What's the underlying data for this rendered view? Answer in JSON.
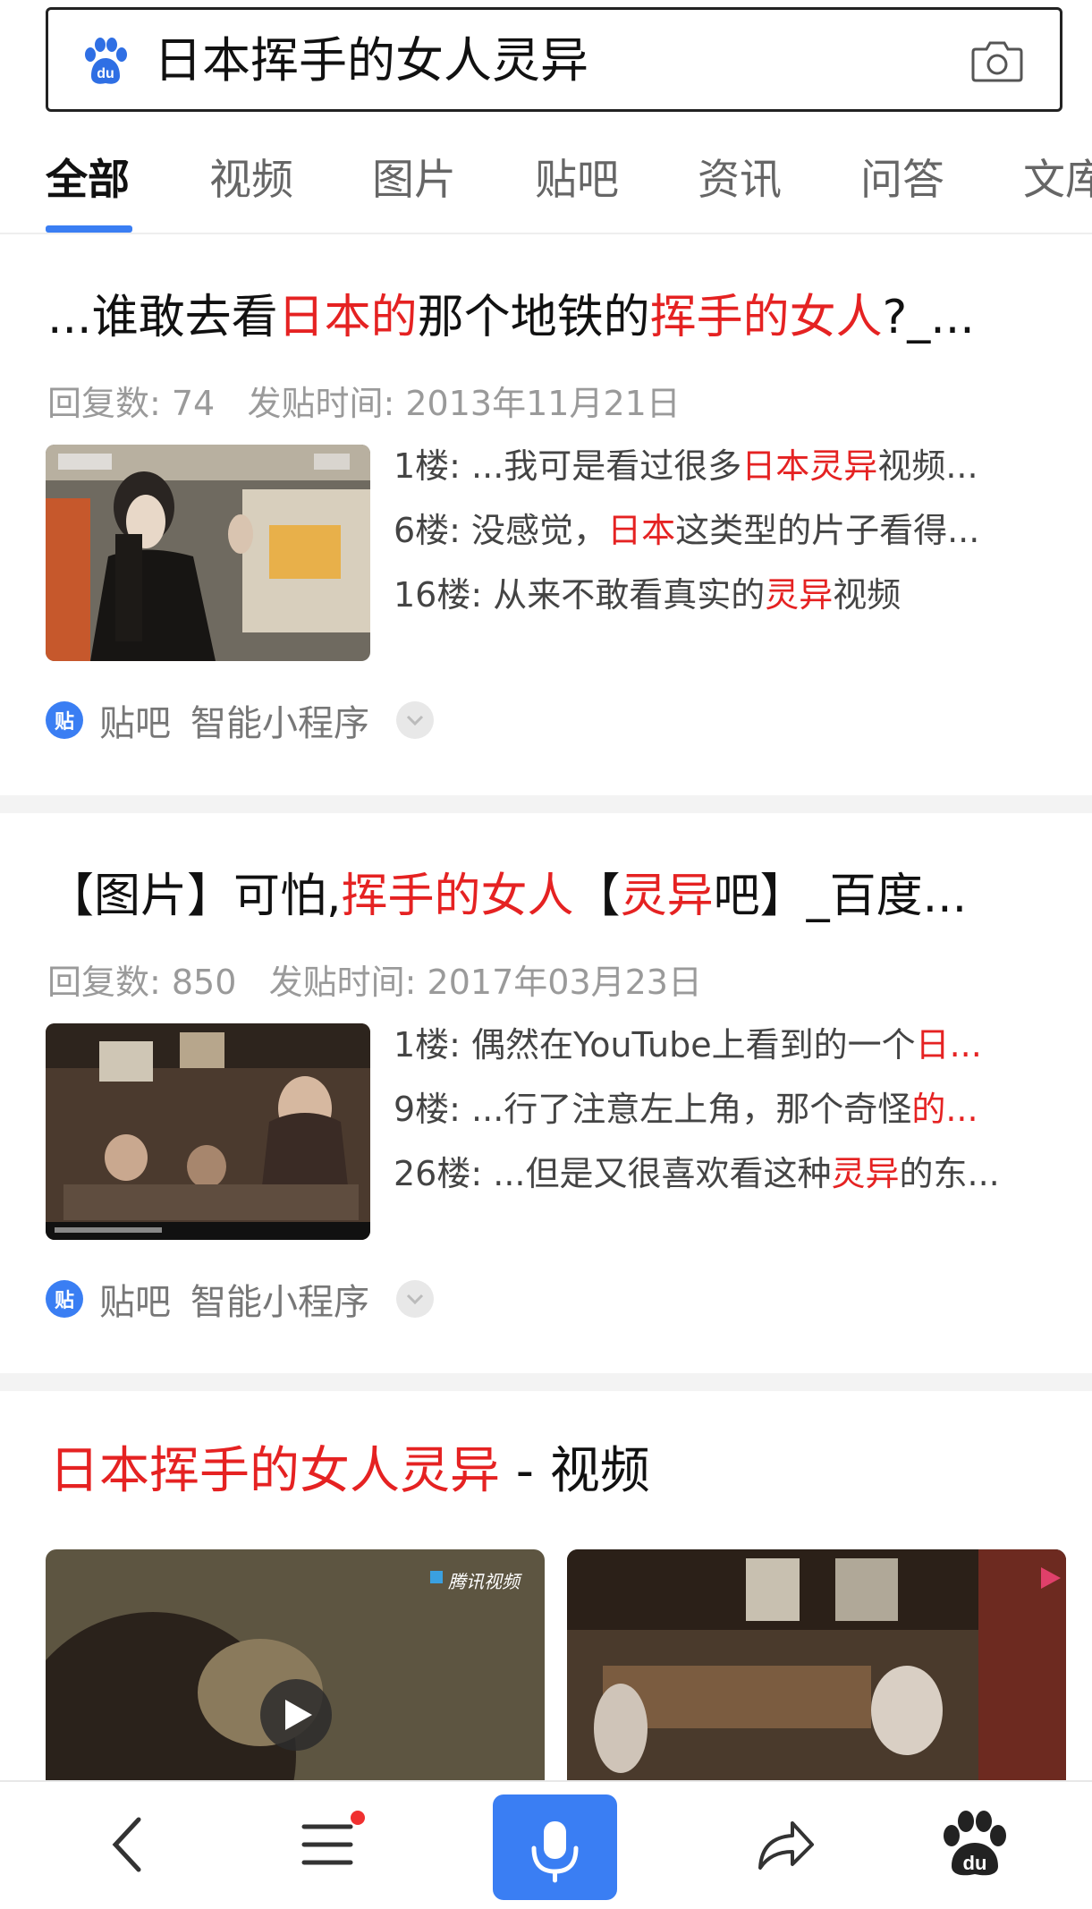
{
  "search": {
    "query": "日本挥手的女人灵异",
    "logo_icon": "baidu-paw-icon",
    "camera_icon": "camera-icon"
  },
  "tabs": [
    {
      "label": "全部",
      "active": true
    },
    {
      "label": "视频",
      "active": false
    },
    {
      "label": "图片",
      "active": false
    },
    {
      "label": "贴吧",
      "active": false
    },
    {
      "label": "资讯",
      "active": false
    },
    {
      "label": "问答",
      "active": false
    },
    {
      "label": "文库",
      "active": false
    }
  ],
  "results": [
    {
      "title_parts": [
        {
          "text": "...谁敢去看",
          "hl": false
        },
        {
          "text": "日本的",
          "hl": true
        },
        {
          "text": "那个地铁的",
          "hl": false
        },
        {
          "text": "挥手的女人",
          "hl": true
        },
        {
          "text": "?_...",
          "hl": false
        }
      ],
      "replies_label": "回复数: 74",
      "post_time_label": "发贴时间: 2013年11月21日",
      "snippets": [
        [
          {
            "text": "1楼: ...我可是看过很多",
            "hl": false
          },
          {
            "text": "日本灵异",
            "hl": true
          },
          {
            "text": "视频...",
            "hl": false
          }
        ],
        [
          {
            "text": "6楼: 没感觉，",
            "hl": false
          },
          {
            "text": "日本",
            "hl": true
          },
          {
            "text": "这类型的片子看得...",
            "hl": false
          }
        ],
        [
          {
            "text": "16楼: 从来不敢看真实的",
            "hl": false
          },
          {
            "text": "灵异",
            "hl": true
          },
          {
            "text": "视频",
            "hl": false
          }
        ]
      ],
      "source": "贴吧",
      "source_extra": "智能小程序"
    },
    {
      "title_parts": [
        {
          "text": "【图片】可怕,",
          "hl": false
        },
        {
          "text": "挥手的女人",
          "hl": true
        },
        {
          "text": "【",
          "hl": false
        },
        {
          "text": "灵异",
          "hl": true
        },
        {
          "text": "吧】_百度...",
          "hl": false
        }
      ],
      "replies_label": "回复数: 850",
      "post_time_label": "发贴时间: 2017年03月23日",
      "snippets": [
        [
          {
            "text": "1楼: 偶然在YouTube上看到的一个",
            "hl": false
          },
          {
            "text": "日...",
            "hl": true
          }
        ],
        [
          {
            "text": "9楼: ...行了注意左上角，那个奇怪",
            "hl": false
          },
          {
            "text": "的...",
            "hl": true
          }
        ],
        [
          {
            "text": "26楼: ...但是又很喜欢看这种",
            "hl": false
          },
          {
            "text": "灵异",
            "hl": true
          },
          {
            "text": "的东...",
            "hl": false
          }
        ]
      ],
      "source": "贴吧",
      "source_extra": "智能小程序"
    }
  ],
  "video_section": {
    "title_hl": "日本挥手的女人灵异",
    "title_rest": " - 视频",
    "watermark": "腾讯视频"
  },
  "colors": {
    "highlight": "#e52222",
    "accent": "#3a7ef3"
  }
}
